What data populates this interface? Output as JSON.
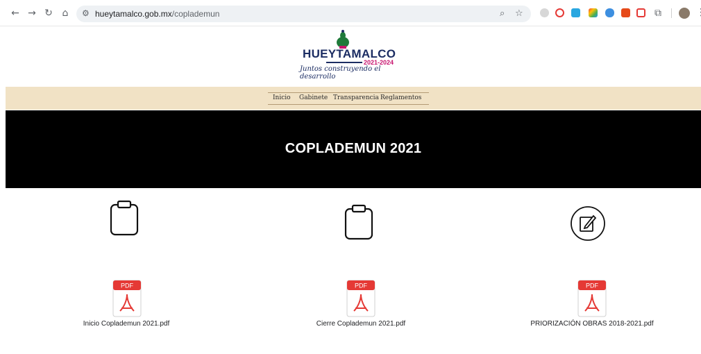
{
  "browser": {
    "url_domain": "hueytamalco.gob.mx",
    "url_path": "/coplademun",
    "colors": {
      "omnibox_bg": "#eef1f4"
    }
  },
  "site": {
    "brand": "HUEYTAMALCO",
    "years": "2021-2024",
    "slogan": "Juntos construyendo el desarrollo",
    "colors": {
      "brand_blue": "#1c2d63",
      "brand_pink": "#c8146e",
      "menu_bg": "#f1e2c5",
      "hero_bg": "#000000"
    }
  },
  "menu": {
    "items": [
      {
        "label": "Inicio"
      },
      {
        "label": "Gabinete"
      },
      {
        "label": "Transparencia"
      },
      {
        "label": "Reglamentos"
      }
    ]
  },
  "hero": {
    "title": "COPLADEMUN 2021"
  },
  "documents": [
    {
      "icon": "clipboard-icon",
      "pdf_tag": "PDF",
      "filename": "Inicio Coplademun 2021.pdf"
    },
    {
      "icon": "clipboard-icon",
      "pdf_tag": "PDF",
      "filename": "Cierre Coplademun 2021.pdf"
    },
    {
      "icon": "edit-circle-icon",
      "pdf_tag": "PDF",
      "filename": "PRIORIZACIÓN OBRAS 2018-2021.pdf"
    }
  ]
}
